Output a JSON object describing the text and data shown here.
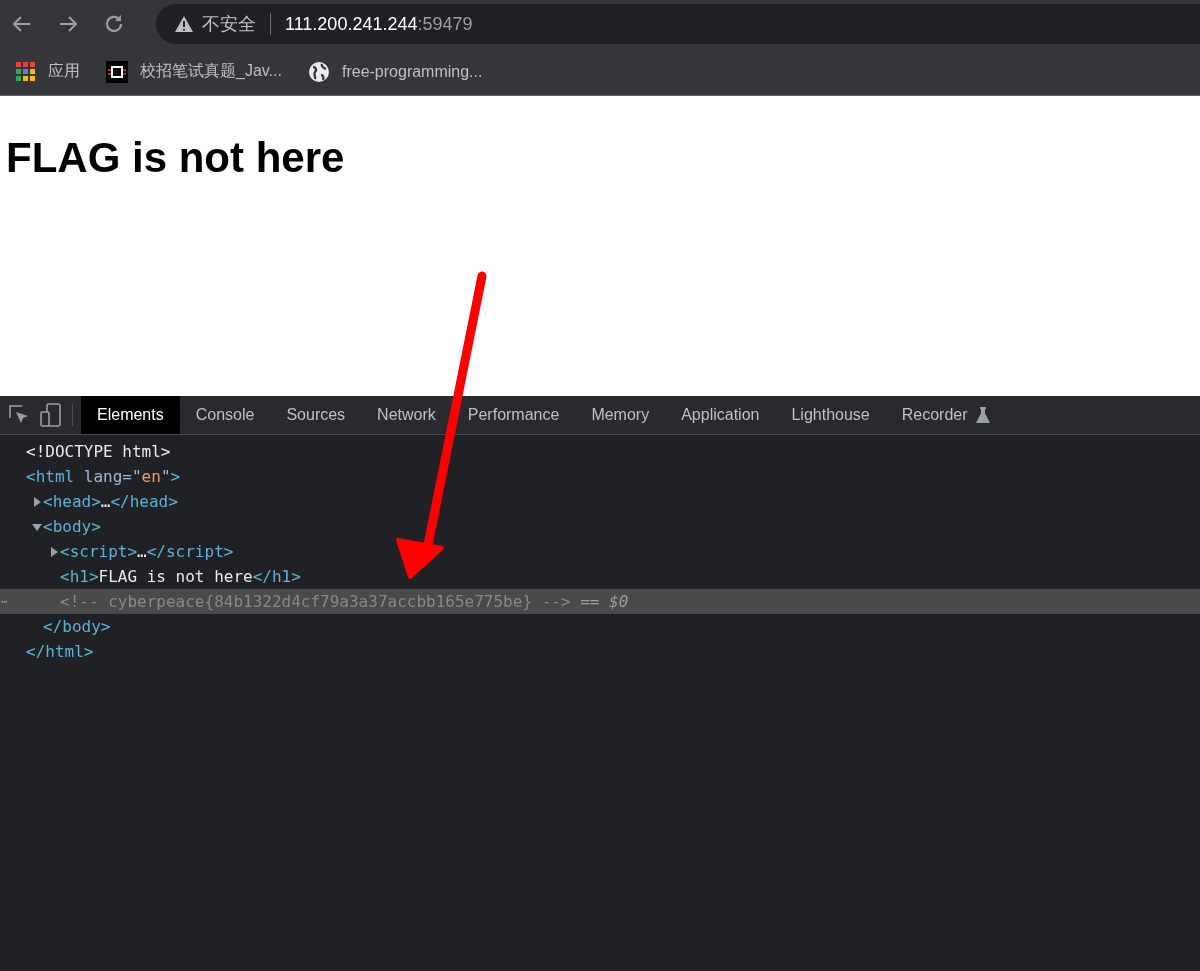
{
  "toolbar": {
    "security_label": "不安全",
    "url_host": "111.200.241.244",
    "url_port": ":59479"
  },
  "bookmarks": [
    {
      "kind": "apps",
      "label": "应用"
    },
    {
      "kind": "site",
      "label": "校招笔试真题_Jav..."
    },
    {
      "kind": "globe",
      "label": "free-programming..."
    }
  ],
  "page": {
    "heading": "FLAG is not here"
  },
  "devtools": {
    "tabs": [
      {
        "label": "Elements",
        "selected": true
      },
      {
        "label": "Console",
        "selected": false
      },
      {
        "label": "Sources",
        "selected": false
      },
      {
        "label": "Network",
        "selected": false
      },
      {
        "label": "Performance",
        "selected": false
      },
      {
        "label": "Memory",
        "selected": false
      },
      {
        "label": "Application",
        "selected": false
      },
      {
        "label": "Lighthouse",
        "selected": false
      },
      {
        "label": "Recorder",
        "selected": false,
        "experimental": true
      }
    ],
    "dom": [
      {
        "selected": false,
        "parts": [
          {
            "kind": "text",
            "s": "<!DOCTYPE html>"
          }
        ]
      },
      {
        "selected": false,
        "parts": [
          {
            "kind": "tag",
            "s": "<html"
          },
          {
            "kind": "attr",
            "s": " lang=\""
          },
          {
            "kind": "value",
            "s": "en"
          },
          {
            "kind": "attr",
            "s": "\""
          },
          {
            "kind": "tag",
            "s": ">"
          }
        ],
        "children": [
          {
            "selected": false,
            "expanded": false,
            "parts": [
              {
                "kind": "tag",
                "s": "<head>"
              },
              {
                "kind": "text",
                "s": "…"
              },
              {
                "kind": "tag",
                "s": "</head>"
              }
            ]
          },
          {
            "selected": false,
            "expanded": true,
            "parts": [
              {
                "kind": "tag",
                "s": "<body>"
              }
            ],
            "children": [
              {
                "selected": false,
                "expanded": false,
                "parts": [
                  {
                    "kind": "tag",
                    "s": "<script>"
                  },
                  {
                    "kind": "text",
                    "s": "…"
                  },
                  {
                    "kind": "tag",
                    "s": "</script>"
                  }
                ]
              },
              {
                "selected": false,
                "parts": [
                  {
                    "kind": "tag",
                    "s": "<h1>"
                  },
                  {
                    "kind": "text",
                    "s": "FLAG is not here"
                  },
                  {
                    "kind": "tag",
                    "s": "</h1>"
                  }
                ]
              },
              {
                "selected": true,
                "gutter": "⋯",
                "parts": [
                  {
                    "kind": "comment",
                    "s": "<!-- cyberpeace{84b1322d4cf79a3a37accbb165e775be} -->"
                  },
                  {
                    "kind": "ref",
                    "s": " == $0"
                  }
                ]
              }
            ],
            "closing": [
              {
                "kind": "tag",
                "s": "</body>"
              }
            ]
          }
        ],
        "closing": [
          {
            "kind": "tag",
            "s": "</html>"
          }
        ]
      }
    ]
  }
}
